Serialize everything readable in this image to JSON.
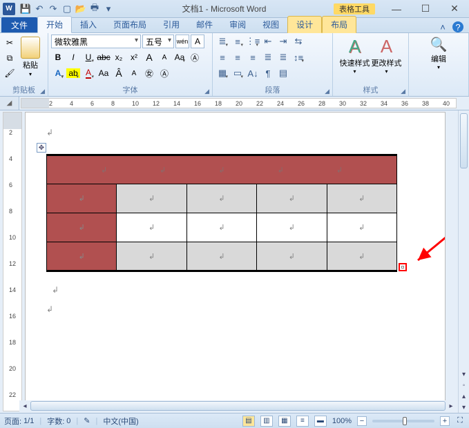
{
  "title": {
    "doc": "文档1",
    "app": "Microsoft Word",
    "context_tab_group": "表格工具"
  },
  "qat": {
    "save": "💾",
    "undo": "↶",
    "redo": "↷",
    "new": "▢",
    "open": "📂",
    "print": "🖶"
  },
  "tabs": {
    "file": "文件",
    "list": [
      "开始",
      "插入",
      "页面布局",
      "引用",
      "邮件",
      "审阅",
      "视图"
    ],
    "context": [
      "设计",
      "布局"
    ],
    "active": "开始"
  },
  "ribbon": {
    "clipboard": {
      "label": "剪贴板",
      "paste": "粘贴"
    },
    "font": {
      "label": "字体",
      "name": "微软雅黑",
      "size": "五号",
      "wen": "wén",
      "grow": "A",
      "shrink": "A",
      "bold": "B",
      "italic": "I",
      "underline": "U",
      "strike": "abc",
      "sub": "x₂",
      "sup": "x²",
      "highlight": "ab",
      "color": "A",
      "clear": "Aa",
      "phonetic": "Aa"
    },
    "paragraph": {
      "label": "段落"
    },
    "styles": {
      "label": "样式",
      "quick": "快速样式",
      "change": "更改样式"
    },
    "editing": {
      "label": "编辑"
    }
  },
  "ruler": {
    "h_marks": [
      2,
      4,
      6,
      8,
      10,
      12,
      14,
      16,
      18,
      20,
      22,
      24,
      26,
      28,
      30,
      32,
      34,
      36,
      38,
      40
    ],
    "v_marks": [
      2,
      4,
      6,
      8,
      10,
      12,
      14,
      16,
      18,
      20,
      22
    ]
  },
  "table": {
    "cell_mark": "↲",
    "rows": [
      {
        "cells": [
          {
            "cls": "red",
            "span": 5
          }
        ]
      },
      {
        "cells": [
          {
            "cls": "red"
          },
          {
            "cls": "grey"
          },
          {
            "cls": "grey"
          },
          {
            "cls": "grey"
          },
          {
            "cls": "grey"
          }
        ]
      },
      {
        "cells": [
          {
            "cls": "red"
          },
          {
            "cls": ""
          },
          {
            "cls": ""
          },
          {
            "cls": ""
          },
          {
            "cls": ""
          }
        ]
      },
      {
        "cells": [
          {
            "cls": "red"
          },
          {
            "cls": "grey"
          },
          {
            "cls": "grey"
          },
          {
            "cls": "grey"
          },
          {
            "cls": "grey"
          }
        ]
      }
    ]
  },
  "status": {
    "page_label": "页面:",
    "page": "1/1",
    "words_label": "字数:",
    "words": "0",
    "lang": "中文(中国)",
    "zoom": "100%"
  }
}
